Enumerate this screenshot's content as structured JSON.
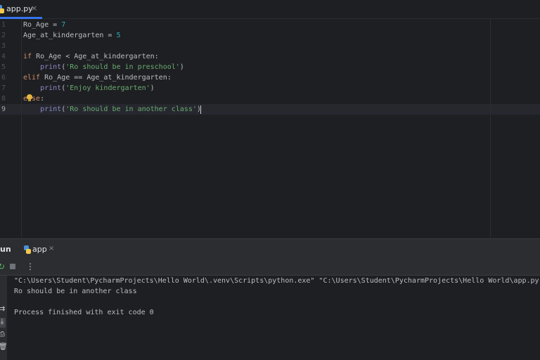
{
  "editor": {
    "tab": {
      "filename": "app.py",
      "close_glyph": "×"
    },
    "lines": [
      {
        "n": "1",
        "tokens": [
          {
            "t": "Ro_Age = ",
            "c": "plain"
          },
          {
            "t": "7",
            "c": "num"
          }
        ]
      },
      {
        "n": "2",
        "tokens": [
          {
            "t": "Age_at_kindergarten = ",
            "c": "plain"
          },
          {
            "t": "5",
            "c": "num"
          }
        ]
      },
      {
        "n": "3",
        "tokens": []
      },
      {
        "n": "4",
        "tokens": [
          {
            "t": "if",
            "c": "kw"
          },
          {
            "t": " Ro_Age < Age_at_kindergarten:",
            "c": "plain"
          }
        ]
      },
      {
        "n": "5",
        "tokens": [
          {
            "t": "    ",
            "c": "plain"
          },
          {
            "t": "print",
            "c": "fn"
          },
          {
            "t": "(",
            "c": "plain"
          },
          {
            "t": "'Ro should be in preschool'",
            "c": "str"
          },
          {
            "t": ")",
            "c": "plain"
          }
        ]
      },
      {
        "n": "6",
        "tokens": [
          {
            "t": "elif",
            "c": "kw"
          },
          {
            "t": " Ro_Age == Age_at_kindergarten:",
            "c": "plain"
          }
        ]
      },
      {
        "n": "7",
        "tokens": [
          {
            "t": "    ",
            "c": "plain"
          },
          {
            "t": "print",
            "c": "fn"
          },
          {
            "t": "(",
            "c": "plain"
          },
          {
            "t": "'Enjoy kindergarten'",
            "c": "str"
          },
          {
            "t": ")",
            "c": "plain"
          }
        ]
      },
      {
        "n": "8",
        "tokens": [
          {
            "t": "else",
            "c": "kw"
          },
          {
            "t": ":",
            "c": "plain"
          }
        ]
      },
      {
        "n": "9",
        "tokens": [
          {
            "t": "    ",
            "c": "plain"
          },
          {
            "t": "print",
            "c": "fn"
          },
          {
            "t": "(",
            "c": "plain"
          },
          {
            "t": "'Ro should be in another class'",
            "c": "str"
          },
          {
            "t": ")",
            "c": "plain"
          }
        ],
        "active": true
      }
    ],
    "intention_icon": "lightbulb-icon"
  },
  "run": {
    "title": "un",
    "tab_label": "app",
    "close_glyph": "×",
    "toolbar": {
      "rerun_icon": "rerun-icon",
      "stop_icon": "stop-icon",
      "more_glyph": "⋮"
    },
    "side_tools": [
      {
        "name": "soft-wrap-icon",
        "glyph": "⇉"
      },
      {
        "name": "scroll-to-end-icon",
        "glyph": "⤓",
        "active": true
      },
      {
        "name": "print-icon",
        "glyph": "⎙"
      },
      {
        "name": "trash-icon",
        "glyph": "🗑"
      }
    ],
    "console": {
      "command": "\"C:\\Users\\Student\\PycharmProjects\\Hello World\\.venv\\Scripts\\python.exe\" \"C:\\Users\\Student\\PycharmProjects\\Hello World\\app.py\"",
      "output": "Ro should be in another class",
      "exit": "Process finished with exit code 0"
    }
  },
  "colors": {
    "accent": "#3574f0",
    "keyword": "#cf8e6d",
    "number": "#2aacb8",
    "string": "#6aab73",
    "builtin": "#8888c6"
  }
}
